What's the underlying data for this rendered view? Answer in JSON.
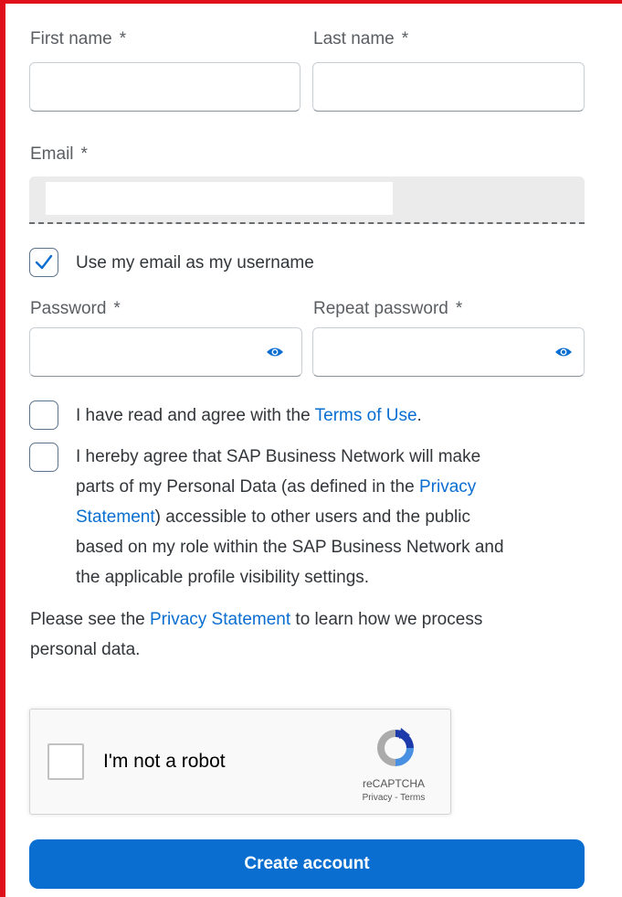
{
  "form": {
    "first_name_label": "First name",
    "last_name_label": "Last name",
    "email_label": "Email",
    "required_marker": "*",
    "first_name_value": "",
    "last_name_value": "",
    "email_value": "",
    "use_email_username_label": "Use my email as my username",
    "use_email_username_checked": true,
    "password_label": "Password",
    "repeat_password_label": "Repeat password",
    "password_value": "",
    "repeat_password_value": ""
  },
  "consent": {
    "terms_prefix": "I have read and agree with the ",
    "terms_link": "Terms of Use",
    "terms_suffix": ".",
    "privacy_line1": "I hereby agree that SAP Business Network will make",
    "privacy_line2_prefix": "parts of my Personal Data (as defined in the ",
    "privacy_line2_link": "Privacy",
    "privacy_line3_link": "Statement",
    "privacy_line3_suffix": ") accessible to other users and the public",
    "privacy_line4": "based on my role within the SAP Business Network and",
    "privacy_line5": "the applicable profile visibility settings.",
    "notice_prefix": "Please see the ",
    "notice_link": "Privacy Statement",
    "notice_suffix": " to learn how we process",
    "notice_line2": "personal data."
  },
  "captcha": {
    "label": "I'm not a robot",
    "brand": "reCAPTCHA",
    "links": "Privacy - Terms"
  },
  "actions": {
    "create_account_label": "Create account"
  },
  "colors": {
    "accent": "#0a6ed1",
    "frame": "#e0101a"
  }
}
